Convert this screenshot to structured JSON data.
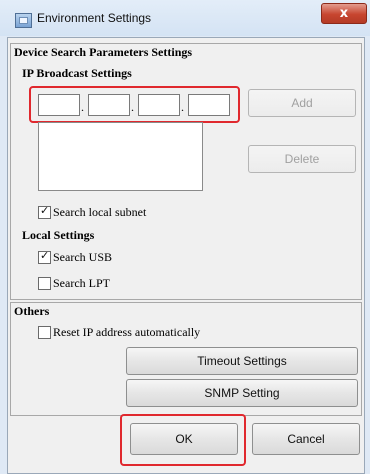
{
  "window": {
    "title": "Environment Settings",
    "close_glyph": "x",
    "icon": "app-settings-icon"
  },
  "device_search": {
    "title": "Device Search Parameters Settings",
    "ip_broadcast": {
      "title": "IP Broadcast Settings",
      "ip_octets": [
        "",
        "",
        "",
        ""
      ],
      "dot": ".",
      "add_label": "Add",
      "delete_label": "Delete",
      "search_local_subnet": {
        "label": "Search local subnet",
        "checked": true
      }
    },
    "local": {
      "title": "Local Settings",
      "search_usb": {
        "label": "Search USB",
        "checked": true
      },
      "search_lpt": {
        "label": "Search LPT",
        "checked": false
      }
    }
  },
  "others": {
    "title": "Others",
    "reset_ip": {
      "label": "Reset IP address automatically",
      "checked": false
    },
    "timeout_label": "Timeout Settings",
    "snmp_label": "SNMP Setting"
  },
  "footer": {
    "ok_label": "OK",
    "cancel_label": "Cancel"
  },
  "colors": {
    "highlight": "#e0282e",
    "close_button": "#c7452f"
  },
  "check_glyph": "✓"
}
